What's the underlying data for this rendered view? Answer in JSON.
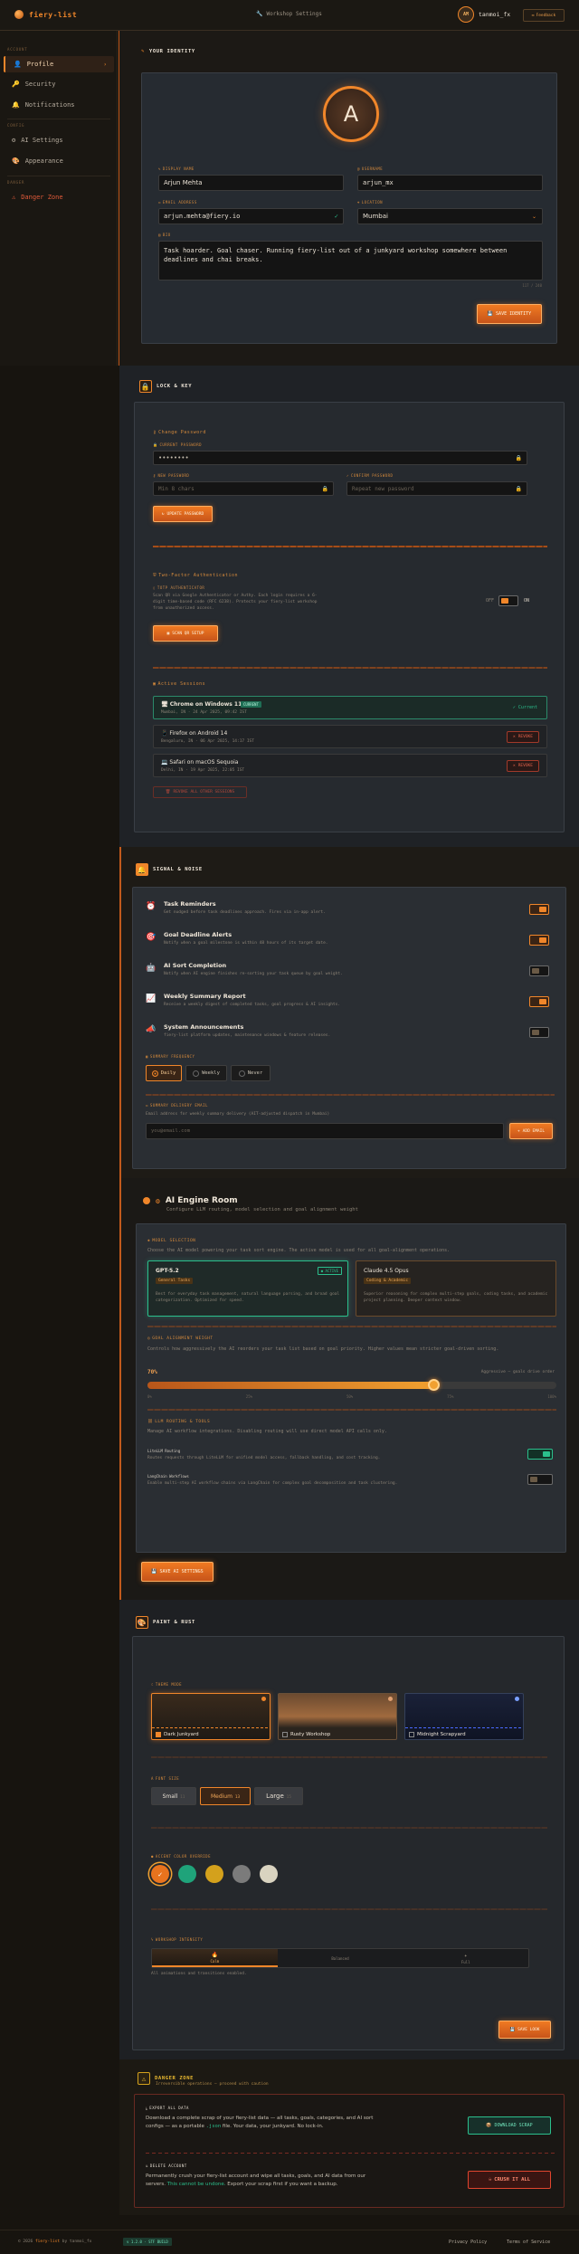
{
  "app": {
    "name": "fiery-list",
    "breadcrumb": "Workshop Settings",
    "user_initials": "AM",
    "user_name": "tanmoi_fx",
    "feedback_label": "Feedback"
  },
  "sidebar": {
    "group_account": "ACCOUNT",
    "group_config": "CONFIG",
    "group_danger": "DANGER",
    "items": [
      {
        "label": "Profile",
        "icon": "user-icon"
      },
      {
        "label": "Security",
        "icon": "key-icon"
      },
      {
        "label": "Notifications",
        "icon": "bell-icon"
      },
      {
        "label": "AI Settings",
        "icon": "gear-icon"
      },
      {
        "label": "Appearance",
        "icon": "palette-icon"
      },
      {
        "label": "Danger Zone",
        "icon": "warning-icon"
      }
    ]
  },
  "identity": {
    "title": "YOUR IDENTITY",
    "avatar_letter": "A",
    "display_name_label": "DISPLAY NAME",
    "display_name": "Arjun Mehta",
    "username_label": "USERNAME",
    "username": "arjun_mx",
    "email_label": "EMAIL ADDRESS",
    "email": "arjun.mehta@fiery.io",
    "location_label": "LOCATION",
    "location": "Mumbai",
    "bio_label": "BIO",
    "bio": "Task hoarder. Goal chaser. Running fiery-list out of a junkyard workshop somewhere between deadlines and chai breaks.",
    "bio_count": "117 / 240",
    "save_label": "SAVE IDENTITY"
  },
  "security": {
    "title": "LOCK & KEY",
    "change_password_title": "Change Password",
    "current_label": "CURRENT PASSWORD",
    "current_value": "••••••••",
    "new_label": "NEW PASSWORD",
    "new_placeholder": "Min 8 chars",
    "confirm_label": "CONFIRM PASSWORD",
    "confirm_placeholder": "Repeat new password",
    "update_label": "UPDATE PASSWORD",
    "twofa_title": "Two-Factor Authentication",
    "twofa_sub": "TOTP AUTHENTICATOR",
    "twofa_desc": "Scan QR via Google Authenticator or Authy. Each login requires a 6-digit time-based code (RFC 6238). Protects your fiery-list workshop from unauthorized access.",
    "twofa_state": "OFF",
    "twofa_state_on": "ON",
    "twofa_btn": "SCAN QR SETUP",
    "sessions_title": "Active Sessions",
    "sessions": [
      {
        "device": "Chrome on Windows 11",
        "badge": "CURRENT",
        "meta": "Mumbai, IN · 24 Apr 2025, 09:42 IST",
        "action": "Current"
      },
      {
        "device": "Firefox on Android 14",
        "meta": "Bengaluru, IN · 06 Apr 2025, 14:17 IST",
        "action": "REVOKE"
      },
      {
        "device": "Safari on macOS Sequoia",
        "meta": "Delhi, IN · 19 Apr 2025, 22:05 IST",
        "action": "REVOKE"
      }
    ],
    "revoke_all": "REVOKE ALL OTHER SESSIONS"
  },
  "notifications": {
    "title": "SIGNAL & NOISE",
    "items": [
      {
        "title": "Task Reminders",
        "desc": "Get nudged before task deadlines approach. Fires via in-app alert.",
        "on": true,
        "icon": "clock-icon"
      },
      {
        "title": "Goal Deadline Alerts",
        "desc": "Notify when a goal milestone is within 48 hours of its target date.",
        "on": true,
        "icon": "target-icon"
      },
      {
        "title": "AI Sort Completion",
        "desc": "Notify when AI engine finishes re-sorting your task queue by goal weight.",
        "on": false,
        "icon": "robot-icon"
      },
      {
        "title": "Weekly Summary Report",
        "desc": "Receive a weekly digest of completed tasks, goal progress & AI insights.",
        "on": true,
        "icon": "chart-icon"
      },
      {
        "title": "System Announcements",
        "desc": "fiery-list platform updates, maintenance windows & feature releases.",
        "on": false,
        "icon": "megaphone-icon"
      }
    ],
    "freq_label": "SUMMARY FREQUENCY",
    "freq": [
      "Daily",
      "Weekly",
      "Never"
    ],
    "email_label": "SUMMARY DELIVERY EMAIL",
    "email_desc": "Email address for weekly summary delivery (AIT-adjusted dispatch in Mumbai)",
    "email_placeholder": "you@email.com",
    "email_btn": "ADD EMAIL"
  },
  "ai": {
    "title": "AI Engine Room",
    "subtitle": "Configure LLM routing, model selection and goal alignment weight",
    "model_section": "MODEL SELECTION",
    "model_desc": "Choose the AI model powering your task sort engine. The active model is used for all goal-alignment operations.",
    "models": [
      {
        "name": "GPT-5.2",
        "tag": "General Tasks",
        "badge": "ACTIVE",
        "desc": "Best for everyday task management, natural language parsing, and broad goal categorization. Optimized for speed."
      },
      {
        "name": "Claude 4.5 Opus",
        "tag": "Coding & Academic",
        "desc": "Superior reasoning for complex multi-step goals, coding tasks, and academic project planning. Deeper context window."
      }
    ],
    "weight_section": "GOAL ALIGNMENT WEIGHT",
    "weight_desc": "Controls how aggressively the AI reorders your task list based on goal priority. Higher values mean stricter goal-driven sorting.",
    "weight_value": "70%",
    "weight_fraction": 0.7,
    "weight_hint": "Aggressive — goals drive order",
    "ticks": [
      "0%",
      "25%",
      "50%",
      "75%",
      "100%"
    ],
    "llm_section": "LLM ROUTING & TOOLS",
    "llm_desc": "Manage AI workflow integrations. Disabling routing will use direct model API calls only.",
    "routing_title": "LiteLLM Routing",
    "routing_desc": "Routes requests through LiteLLM for unified model access, fallback handling, and cost tracking.",
    "langchain_title": "LangChain Workflows",
    "langchain_desc": "Enable multi-step AI workflow chains via LangChain for complex goal decomposition and task clustering.",
    "save_label": "SAVE AI SETTINGS"
  },
  "appearance": {
    "title": "PAINT & RUST",
    "theme_label": "THEME MODE",
    "themes": [
      "Dark Junkyard",
      "Rusty Workshop",
      "Midnight Scrapyard"
    ],
    "font_label": "FONT SIZE",
    "fonts": [
      "Small",
      "Medium",
      "Large"
    ],
    "font_suffix": [
      "11",
      "13",
      "15"
    ],
    "accent_label": "ACCENT COLOR OVERRIDE",
    "accent_colors": [
      "#e8731e",
      "#1fa37a",
      "#d4a11c",
      "#7b7b7b",
      "#d9d3c0"
    ],
    "anim_label": "WORKSHOP INTENSITY",
    "anim_levels": [
      "Calm",
      "Balanced",
      "Full"
    ],
    "anim_desc": "All animations and transitions enabled.",
    "save_label": "SAVE LOOK"
  },
  "danger": {
    "title": "DANGER ZONE",
    "subtitle": "Irreversible operations — proceed with caution",
    "export_title": "EXPORT ALL DATA",
    "export_desc_1": "Download a complete scrap of your fiery-list data — all tasks, goals, categories, and AI sort configs — as a portable ",
    "export_desc_code": ".json",
    "export_desc_2": " file. Your data, your junkyard. No lock-in.",
    "export_btn": "DOWNLOAD SCRAP",
    "delete_title": "DELETE ACCOUNT",
    "delete_desc_1": "Permanently crush your fiery-list account and wipe all tasks, goals, and AI data from our servers. ",
    "delete_desc_em": "This cannot be undone.",
    "delete_desc_2": " Export your scrap first if you want a backup.",
    "delete_btn": "CRUSH IT ALL"
  },
  "footer": {
    "copyright": "© 2026 ",
    "brand": "fiery-list",
    "by": " by tanmoi_fx",
    "version": "v 1.2.0 · STF BUILD",
    "privacy": "Privacy Policy",
    "terms": "Terms of Service"
  },
  "colors": {
    "accent": "#f0862a",
    "panel": "#252a30",
    "bg": "#17140f",
    "danger": "#e0452e",
    "teal": "#2bbf8c"
  }
}
